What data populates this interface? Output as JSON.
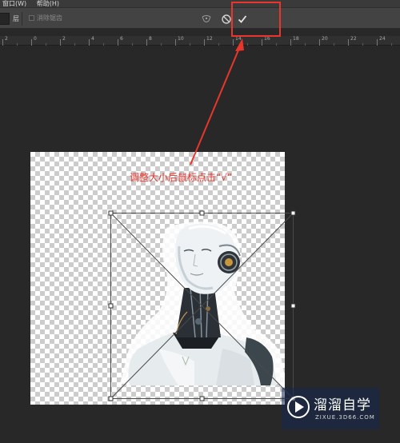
{
  "menubar": {
    "items": [
      "窗口(W)",
      "帮助(H)"
    ]
  },
  "options_bar": {
    "field_label": "层",
    "checkbox_label": "消除锯齿",
    "icons": [
      "warp-mode-icon",
      "cancel-transform-icon",
      "commit-transform-icon"
    ]
  },
  "ruler": {
    "labels": [
      "2",
      "0",
      "2",
      "4",
      "6",
      "8",
      "10",
      "12",
      "14",
      "16",
      "18",
      "20",
      "22",
      "24"
    ]
  },
  "canvas": {
    "annotation": "调整大小后鼠标点击“√”"
  },
  "watermark": {
    "title": "溜溜自学",
    "url": "ZIXUE.3D66.COM"
  },
  "colors": {
    "annotation_red": "#e8362c",
    "panel_dark": "#282828",
    "options_bar": "#434343"
  }
}
